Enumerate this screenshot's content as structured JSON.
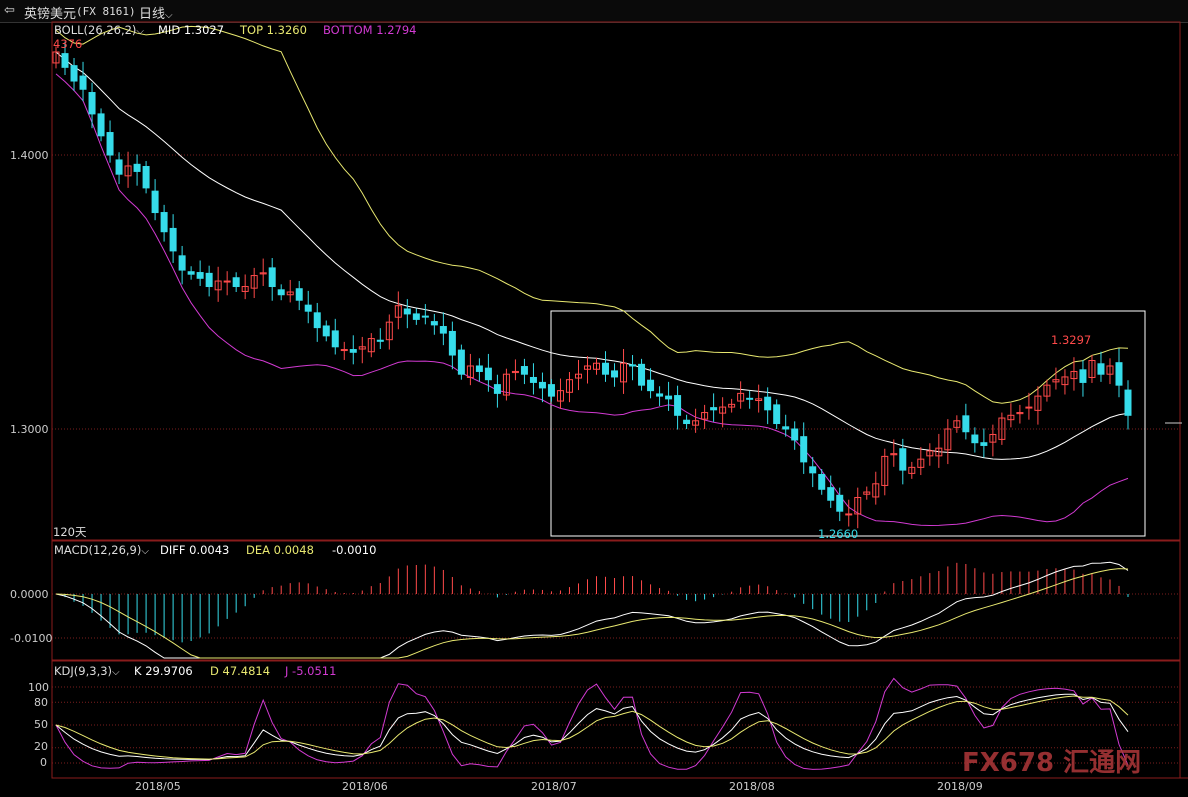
{
  "header": {
    "back_symbol": "⇦",
    "instrument_name": "英镑美元",
    "instrument_code": "(FX 8161)",
    "period": "日线",
    "dropdown_symbol": "⌵"
  },
  "boll": {
    "label": "BOLL(26,26,2)",
    "mid": "MID 1.3027",
    "top": "TOP 1.3260",
    "bottom": "BOTTOM 1.2794",
    "dropdown_symbol": "⌵"
  },
  "main_axis": {
    "labels": [
      "1.4000",
      "1.3000"
    ]
  },
  "annotations": {
    "high_left": "4376",
    "high_recent": "1.3297",
    "low": "1.2660",
    "range_label": "120天"
  },
  "macd": {
    "label": "MACD(12,26,9)",
    "diff": "DIFF 0.0043",
    "dea": "DEA 0.0048",
    "value": "-0.0010",
    "axis_labels": [
      "0.0000",
      "-0.0100"
    ],
    "dropdown_symbol": "⌵"
  },
  "kdj": {
    "label": "KDJ(9,3,3)",
    "k": "K 29.9706",
    "d": "D 47.4814",
    "j": "J -5.0511",
    "axis_labels": [
      "100",
      "80",
      "50",
      "20",
      "0"
    ],
    "dropdown_symbol": "⌵"
  },
  "x_axis": {
    "labels": [
      "2018/05",
      "2018/06",
      "2018/07",
      "2018/08",
      "2018/09"
    ]
  },
  "watermark": "FX678 汇通网",
  "colors": {
    "up": "#ff4a4a",
    "down": "#36dcea",
    "mid": "#ffffff",
    "top": "#e8e870",
    "bottom": "#d23ad2",
    "grid": "#7a1e1e",
    "highlight": "#ffffff"
  },
  "chart_data": {
    "type": "candlestick",
    "ylim": [
      1.262,
      1.452
    ],
    "closes": [
      1.4376,
      1.432,
      1.427,
      1.424,
      1.415,
      1.407,
      1.4,
      1.393,
      1.396,
      1.394,
      1.388,
      1.379,
      1.372,
      1.365,
      1.358,
      1.3565,
      1.355,
      1.352,
      1.354,
      1.354,
      1.352,
      1.352,
      1.356,
      1.357,
      1.352,
      1.349,
      1.35,
      1.347,
      1.343,
      1.337,
      1.334,
      1.33,
      1.329,
      1.328,
      1.33,
      1.333,
      1.332,
      1.339,
      1.345,
      1.342,
      1.34,
      1.341,
      1.338,
      1.335,
      1.327,
      1.32,
      1.323,
      1.321,
      1.318,
      1.313,
      1.32,
      1.321,
      1.32,
      1.317,
      1.315,
      1.312,
      1.314,
      1.318,
      1.32,
      1.323,
      1.324,
      1.32,
      1.319,
      1.324,
      1.323,
      1.316,
      1.314,
      1.312,
      1.311,
      1.305,
      1.302,
      1.303,
      1.306,
      1.307,
      1.308,
      1.309,
      1.313,
      1.311,
      1.311,
      1.307,
      1.302,
      1.3,
      1.296,
      1.288,
      1.284,
      1.278,
      1.274,
      1.27,
      1.269,
      1.275,
      1.277,
      1.28,
      1.29,
      1.291,
      1.285,
      1.286,
      1.289,
      1.292,
      1.293,
      1.3,
      1.303,
      1.299,
      1.295,
      1.294,
      1.298,
      1.304,
      1.305,
      1.306,
      1.308,
      1.312,
      1.316,
      1.318,
      1.319,
      1.321,
      1.317,
      1.325,
      1.32,
      1.323,
      1.316,
      1.305
    ]
  }
}
